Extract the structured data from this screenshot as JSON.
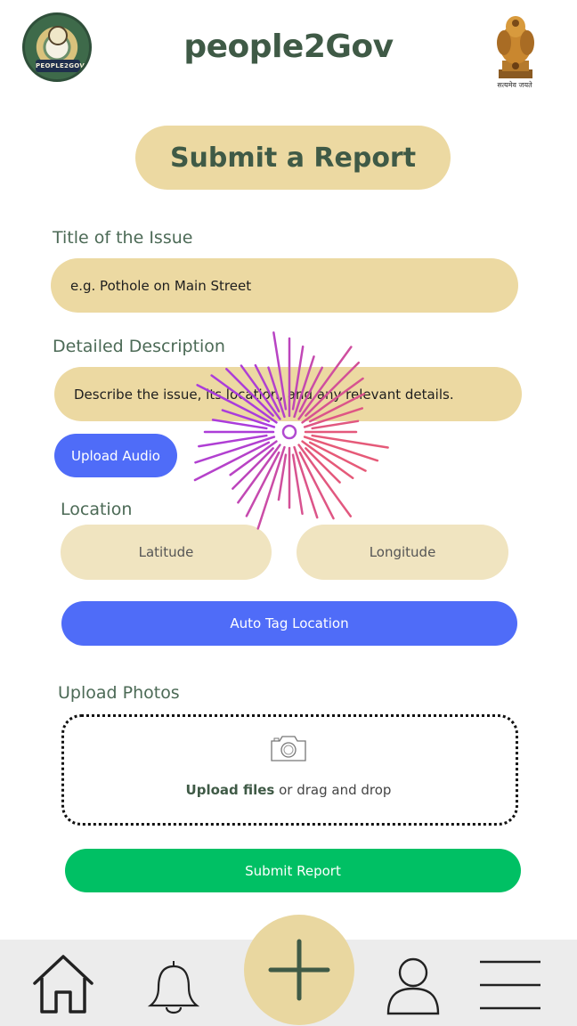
{
  "header": {
    "app_title": "people2Gov",
    "left_logo_text": "PEOPLE2GOV",
    "emblem_caption": "सत्यमेव जयते"
  },
  "form": {
    "heading": "Submit a Report",
    "title_label": "Title of the Issue",
    "title_placeholder": "e.g. Pothole on Main Street",
    "description_label": "Detailed Description",
    "description_placeholder": "Describe the issue, its location, and any relevant details.",
    "upload_audio_label": "Upload Audio",
    "location_label": "Location",
    "latitude_placeholder": "Latitude",
    "longitude_placeholder": "Longitude",
    "auto_tag_label": "Auto Tag Location",
    "photos_label": "Upload Photos",
    "upload_files_link": "Upload files",
    "drag_drop_text": " or drag and drop",
    "submit_label": "Submit Report"
  },
  "nav": {
    "items": [
      "home-icon",
      "bell-icon",
      "plus-icon",
      "profile-icon",
      "menu-icon"
    ]
  },
  "colors": {
    "accent_green": "#3f5a46",
    "pill_beige": "#ecd9a2",
    "button_blue": "#4f6cf8",
    "submit_green": "#00c064"
  }
}
